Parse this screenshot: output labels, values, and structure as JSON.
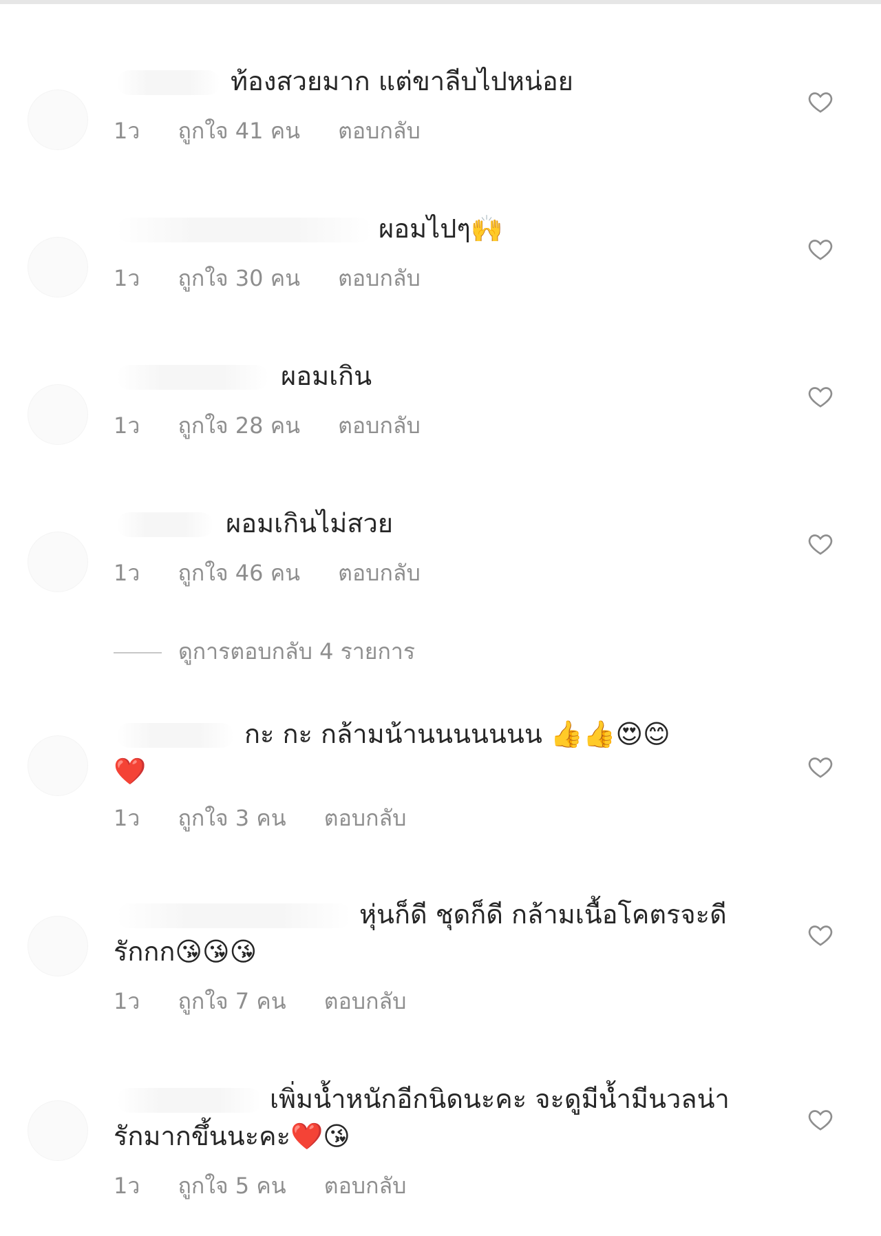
{
  "comments": [
    {
      "text_line1": "ท้องสวยมาก แต่ขาลีบไปหน่อย",
      "text_line2": "",
      "time": "1ว",
      "likes": "ถูกใจ 41 คน",
      "reply": "ตอบกลับ"
    },
    {
      "text_line1": "ผอมไปๆ🙌",
      "text_line2": "",
      "time": "1ว",
      "likes": "ถูกใจ 30 คน",
      "reply": "ตอบกลับ"
    },
    {
      "text_line1": "ผอมเกิน",
      "text_line2": "",
      "time": "1ว",
      "likes": "ถูกใจ 28 คน",
      "reply": "ตอบกลับ"
    },
    {
      "text_line1": "ผอมเกินไม่สวย",
      "text_line2": "",
      "time": "1ว",
      "likes": "ถูกใจ 46 คน",
      "reply": "ตอบกลับ"
    },
    {
      "text_line1": "กะ กะ กล้ามน้านนนนนนน 👍👍😍😊",
      "text_line2": "❤️",
      "time": "1ว",
      "likes": "ถูกใจ 3 คน",
      "reply": "ตอบกลับ"
    },
    {
      "text_line1": "หุ่นก็ดี ชุดก็ดี กล้ามเนื้อโคตรจะดี",
      "text_line2": "รักกก😘😘😘",
      "time": "1ว",
      "likes": "ถูกใจ 7 คน",
      "reply": "ตอบกลับ"
    },
    {
      "text_line1": "เพิ่มน้ำหนักอีกนิดนะคะ จะดูมีน้ำมีนวลน่า",
      "text_line2": "รักมากขึ้นนะคะ❤️😘",
      "time": "1ว",
      "likes": "ถูกใจ 5 คน",
      "reply": "ตอบกลับ"
    }
  ],
  "view_replies": "ดูการตอบกลับ 4 รายการ",
  "icons": {
    "like": "heart-outline-icon"
  },
  "colors": {
    "primary_text": "#262626",
    "secondary_text": "#8e8e8e",
    "background": "#ffffff"
  }
}
